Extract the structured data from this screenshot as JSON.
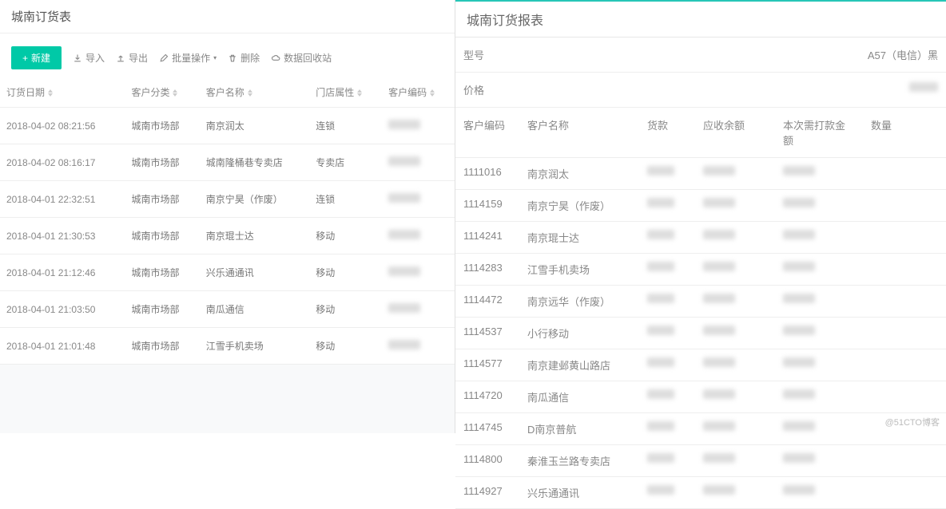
{
  "left": {
    "title": "城南订货表",
    "toolbar": {
      "new": "新建",
      "import": "导入",
      "export": "导出",
      "batch": "批量操作",
      "delete": "删除",
      "recycle": "数据回收站"
    },
    "columns": {
      "date": "订货日期",
      "category": "客户分类",
      "name": "客户名称",
      "attr": "门店属性",
      "code": "客户编码"
    },
    "rows": [
      {
        "date": "2018-04-02 08:21:56",
        "category": "城南市场部",
        "name": "南京润太",
        "attr": "连锁"
      },
      {
        "date": "2018-04-02 08:16:17",
        "category": "城南市场部",
        "name": "城南隆桶巷专卖店",
        "attr": "专卖店"
      },
      {
        "date": "2018-04-01 22:32:51",
        "category": "城南市场部",
        "name": "南京宁昊（作废）",
        "attr": "连锁"
      },
      {
        "date": "2018-04-01 21:30:53",
        "category": "城南市场部",
        "name": "南京琨士达",
        "attr": "移动"
      },
      {
        "date": "2018-04-01 21:12:46",
        "category": "城南市场部",
        "name": "兴乐通通讯",
        "attr": "移动"
      },
      {
        "date": "2018-04-01 21:03:50",
        "category": "城南市场部",
        "name": "南瓜通信",
        "attr": "移动"
      },
      {
        "date": "2018-04-01 21:01:48",
        "category": "城南市场部",
        "name": "江雪手机卖场",
        "attr": "移动"
      }
    ]
  },
  "right": {
    "title": "城南订货报表",
    "model_label": "型号",
    "model_value": "A57（电信）黑",
    "price_label": "价格",
    "columns": {
      "code": "客户编码",
      "name": "客户名称",
      "money": "货款",
      "receivable": "应收余额",
      "pay": "本次需打款金额",
      "qty": "数量"
    },
    "rows": [
      {
        "code": "1111016",
        "name": "南京润太"
      },
      {
        "code": "1114159",
        "name": "南京宁昊（作废）"
      },
      {
        "code": "1114241",
        "name": "南京琨士达"
      },
      {
        "code": "1114283",
        "name": "江雪手机卖场"
      },
      {
        "code": "1114472",
        "name": "南京远华（作废）"
      },
      {
        "code": "1114537",
        "name": "小行移动"
      },
      {
        "code": "1114577",
        "name": "南京建邺黄山路店"
      },
      {
        "code": "1114720",
        "name": "南瓜通信"
      },
      {
        "code": "1114745",
        "name": "D南京普航"
      },
      {
        "code": "1114800",
        "name": "秦淮玉兰路专卖店"
      },
      {
        "code": "1114927",
        "name": "兴乐通通讯"
      }
    ]
  },
  "watermark": "@51CTO博客"
}
